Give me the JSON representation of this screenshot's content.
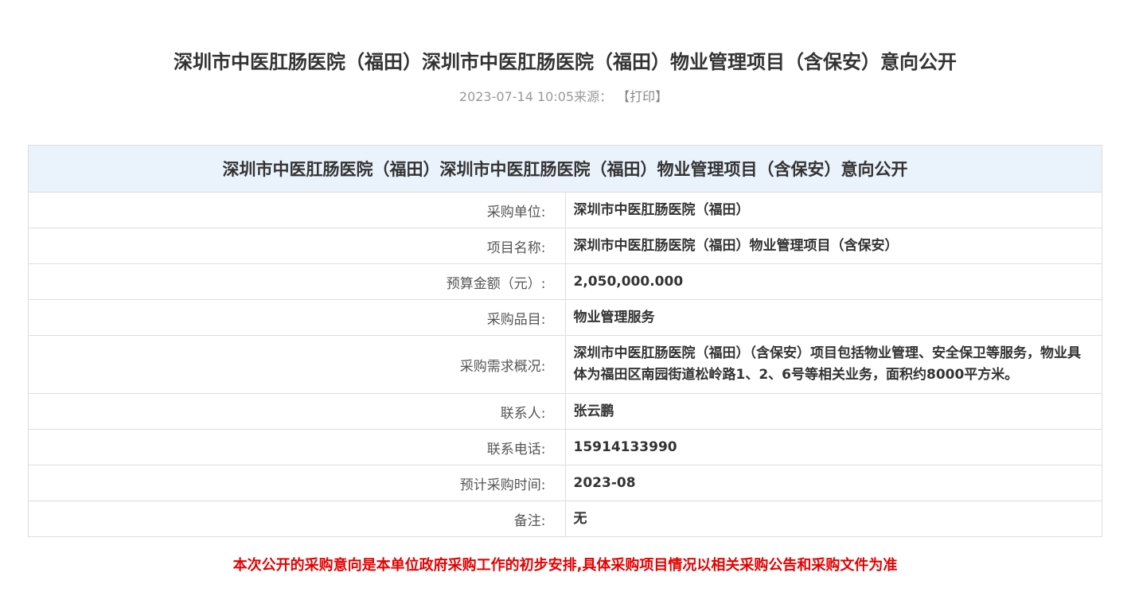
{
  "page": {
    "title": "深圳市中医肛肠医院（福田）深圳市中医肛肠医院（福田）物业管理项目（含保安）意向公开",
    "datetime": "2023-07-14 10:05",
    "source_label": "来源：",
    "print_label": "【打印】"
  },
  "table": {
    "heading": "深圳市中医肛肠医院（福田）深圳市中医肛肠医院（福田）物业管理项目（含保安）意向公开",
    "rows": [
      {
        "label": "采购单位:",
        "value": "深圳市中医肛肠医院（福田）"
      },
      {
        "label": "项目名称:",
        "value": "深圳市中医肛肠医院（福田）物业管理项目（含保安）"
      },
      {
        "label": "预算金额（元）:",
        "value": "2,050,000.000"
      },
      {
        "label": "采购品目:",
        "value": "物业管理服务"
      },
      {
        "label": "采购需求概况:",
        "value": "深圳市中医肛肠医院（福田）（含保安）项目包括物业管理、安全保卫等服务，物业具体为福田区南园街道松岭路1、2、6号等相关业务，面积约8000平方米。"
      },
      {
        "label": "联系人:",
        "value": "张云鹏"
      },
      {
        "label": "联系电话:",
        "value": "15914133990"
      },
      {
        "label": "预计采购时间:",
        "value": "2023-08"
      },
      {
        "label": "备注:",
        "value": "无"
      }
    ]
  },
  "notice": "本次公开的采购意向是本单位政府采购工作的初步安排,具体采购项目情况以相关采购公告和采购文件为准",
  "colors": {
    "header_bg": "#eaf2fb",
    "notice_red": "#e60000",
    "border": "#dddddd",
    "meta_gray": "#999999"
  }
}
